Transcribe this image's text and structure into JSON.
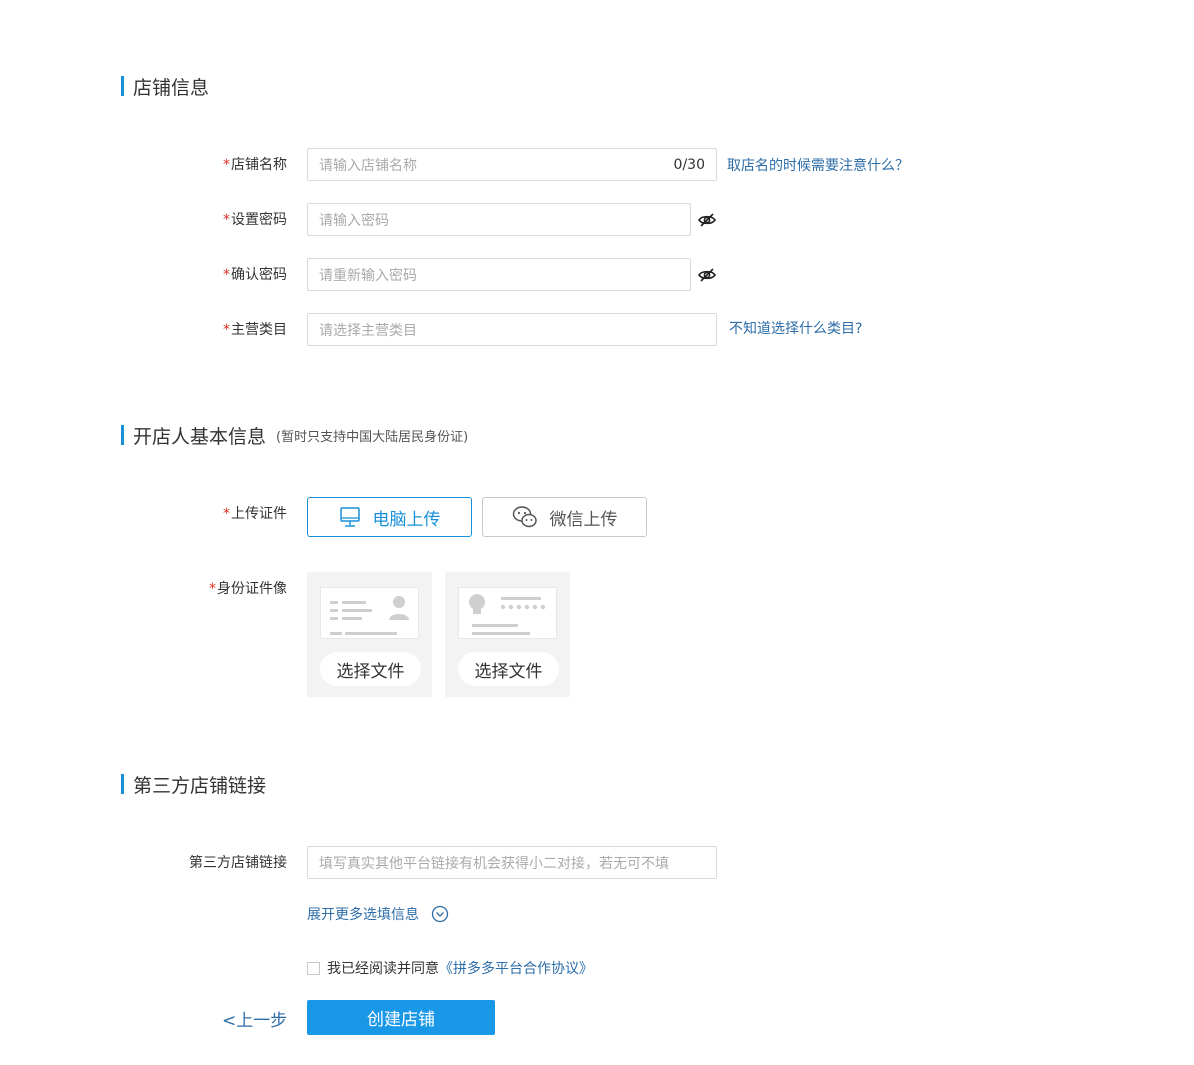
{
  "shop_info": {
    "title": "店铺信息",
    "shop_name": {
      "label": "店铺名称",
      "placeholder": "请输入店铺名称",
      "counter": "0/30",
      "help": "取店名的时候需要注意什么？"
    },
    "password": {
      "label": "设置密码",
      "placeholder": "请输入密码"
    },
    "confirm_password": {
      "label": "确认密码",
      "placeholder": "请重新输入密码"
    },
    "category": {
      "label": "主营类目",
      "placeholder": "请选择主营类目",
      "help": "不知道选择什么类目?"
    }
  },
  "owner_info": {
    "title": "开店人基本信息",
    "note": "(暂时只支持中国大陆居民身份证)",
    "upload_label": "上传证件",
    "upload_pc": "电脑上传",
    "upload_wechat": "微信上传",
    "id_label": "身份证件像",
    "choose_file_front": "选择文件",
    "choose_file_back": "选择文件"
  },
  "third_party": {
    "title": "第三方店铺链接",
    "label": "第三方店铺链接",
    "placeholder": "填写真实其他平台链接有机会获得小二对接，若无可不填",
    "expand": "展开更多选填信息"
  },
  "agreement": {
    "prefix": "我已经阅读并同意",
    "link": "《拼多多平台合作协议》"
  },
  "actions": {
    "back": "<上一步",
    "create": "创建店铺"
  },
  "colors": {
    "accent": "#1890d8",
    "link": "#2d6da8",
    "required": "#e02e24",
    "primary_button": "#1a98e8"
  },
  "icons": {
    "password_toggle": "eye-off-icon",
    "pc_upload": "monitor-icon",
    "wechat_upload": "wechat-icon",
    "expand": "chevron-down-circle-icon"
  }
}
